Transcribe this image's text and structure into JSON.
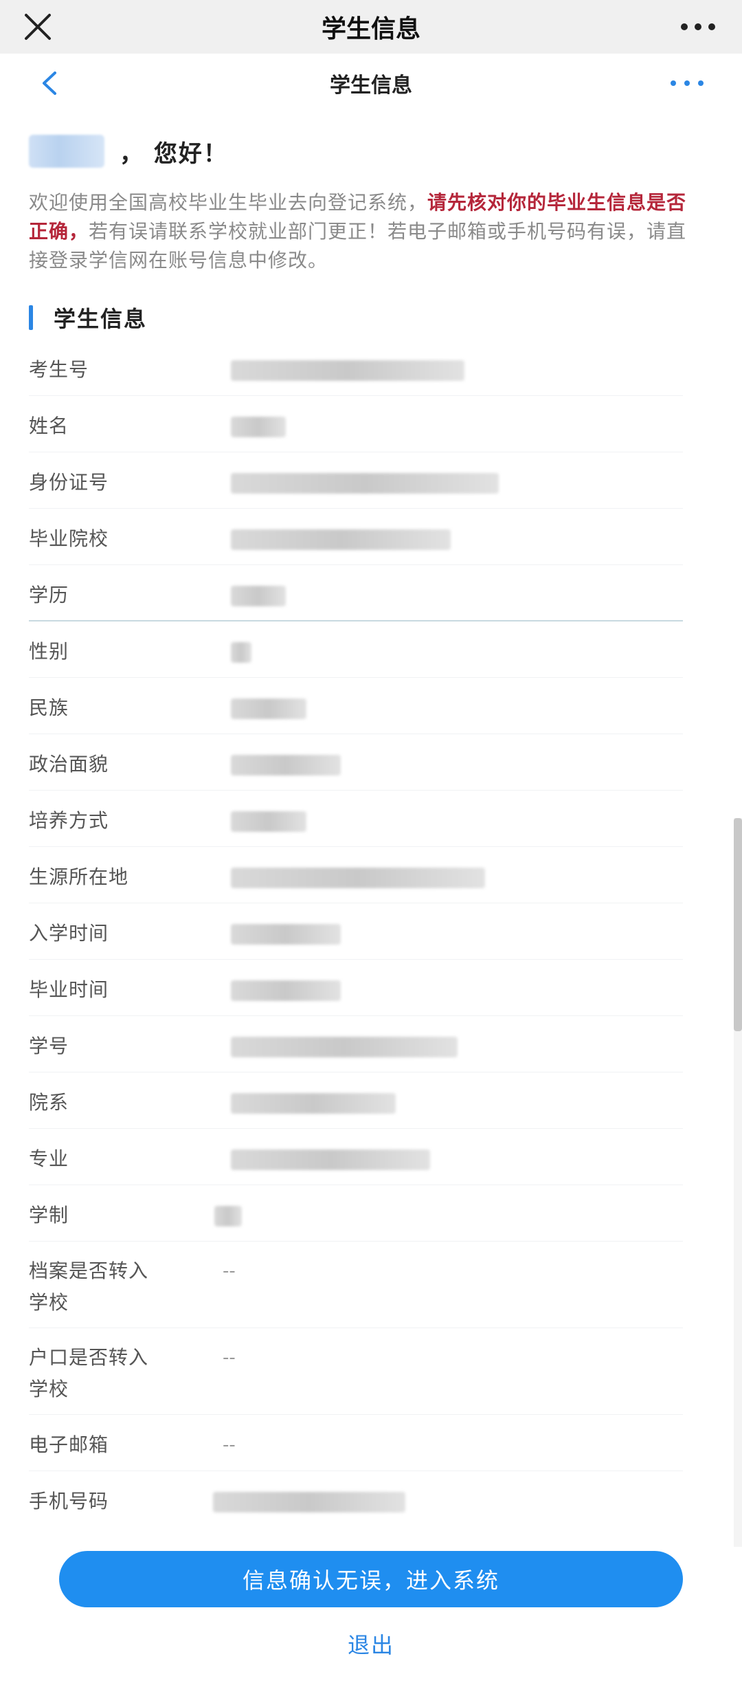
{
  "window": {
    "title": "学生信息",
    "close_icon": "close-icon",
    "more_icon": "more-dots-icon"
  },
  "nav": {
    "title": "学生信息",
    "back_icon": "chevron-left-icon",
    "more_icon": "more-dots-icon"
  },
  "greeting": {
    "suffix": "， 您好！"
  },
  "intro": {
    "part1": "欢迎使用全国高校毕业生毕业去向登记系统，",
    "highlight": "请先核对你的毕业生信息是否正确，",
    "part2": "若有误请联系学校就业部门更正！若电子邮箱或手机号码有误，请直接登录学信网在账号信息中修改。"
  },
  "section": {
    "title": "学生信息"
  },
  "fields": [
    {
      "label": "考生号",
      "value": ""
    },
    {
      "label": "姓名",
      "value": ""
    },
    {
      "label": "身份证号",
      "value": ""
    },
    {
      "label": "毕业院校",
      "value": ""
    },
    {
      "label": "学历",
      "value": ""
    },
    {
      "label": "性别",
      "value": ""
    },
    {
      "label": "民族",
      "value": ""
    },
    {
      "label": "政治面貌",
      "value": ""
    },
    {
      "label": "培养方式",
      "value": ""
    },
    {
      "label": "生源所在地",
      "value": ""
    },
    {
      "label": "入学时间",
      "value": ""
    },
    {
      "label": "毕业时间",
      "value": ""
    },
    {
      "label": "学号",
      "value": ""
    },
    {
      "label": "院系",
      "value": ""
    },
    {
      "label": "专业",
      "value": ""
    },
    {
      "label": "学制",
      "value": ""
    },
    {
      "label": "档案是否转入\n学校",
      "value": "--"
    },
    {
      "label": "户口是否转入\n学校",
      "value": "--"
    },
    {
      "label": "电子邮箱",
      "value": "--"
    },
    {
      "label": "手机号码",
      "value": ""
    }
  ],
  "actions": {
    "confirm": "信息确认无误，进入系统",
    "exit": "退出"
  },
  "colors": {
    "accent": "#2b86e4",
    "button": "#1f8ef0",
    "highlight": "#b5263a"
  }
}
